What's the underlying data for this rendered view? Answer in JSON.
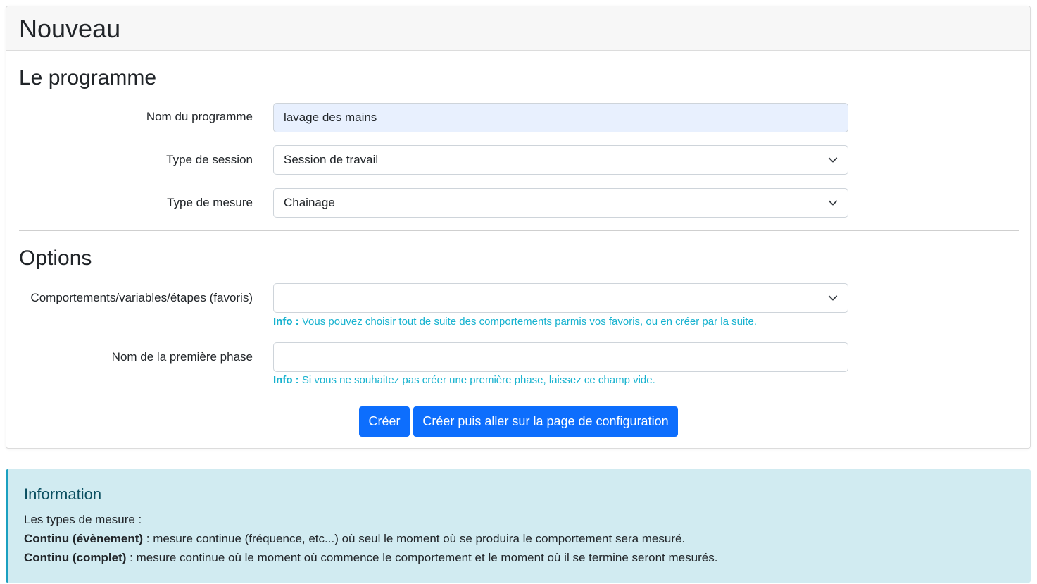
{
  "card": {
    "title": "Nouveau",
    "section1": "Le programme",
    "section2": "Options"
  },
  "form": {
    "program_name_label": "Nom du programme",
    "program_name_value": "lavage des mains",
    "session_type_label": "Type de session",
    "session_type_value": "Session de travail",
    "measure_type_label": "Type de mesure",
    "measure_type_value": "Chainage",
    "behaviors_label": "Comportements/variables/étapes (favoris)",
    "behaviors_value": "",
    "behaviors_info_prefix": "Info :",
    "behaviors_info_text": "Vous pouvez choisir tout de suite des comportements parmis vos favoris, ou en créer par la suite.",
    "first_phase_label": "Nom de la première phase",
    "first_phase_value": "",
    "first_phase_info_prefix": "Info :",
    "first_phase_info_text": "Si vous ne souhaitez pas créer une première phase, laissez ce champ vide."
  },
  "buttons": {
    "create": "Créer",
    "create_configure": "Créer puis aller sur la page de configuration"
  },
  "alert": {
    "title": "Information",
    "intro": "Les types de mesure :",
    "line1_bold": "Continu (évènement)",
    "line1_text": " : mesure continue (fréquence, etc...) où seul le moment où se produira le comportement sera mesuré.",
    "line2_bold": "Continu (complet)",
    "line2_text": " : mesure continue où le moment où commence le comportement et le moment où il se termine seront mesurés."
  },
  "colors": {
    "primary": "#0d6efd",
    "info_text": "#17b2cf",
    "alert_bg": "#d1ebf1",
    "alert_border": "#1aa0c0",
    "autofill_bg": "#e8f0fe"
  },
  "icons": {
    "select_chevron": "chevron-down-icon"
  }
}
